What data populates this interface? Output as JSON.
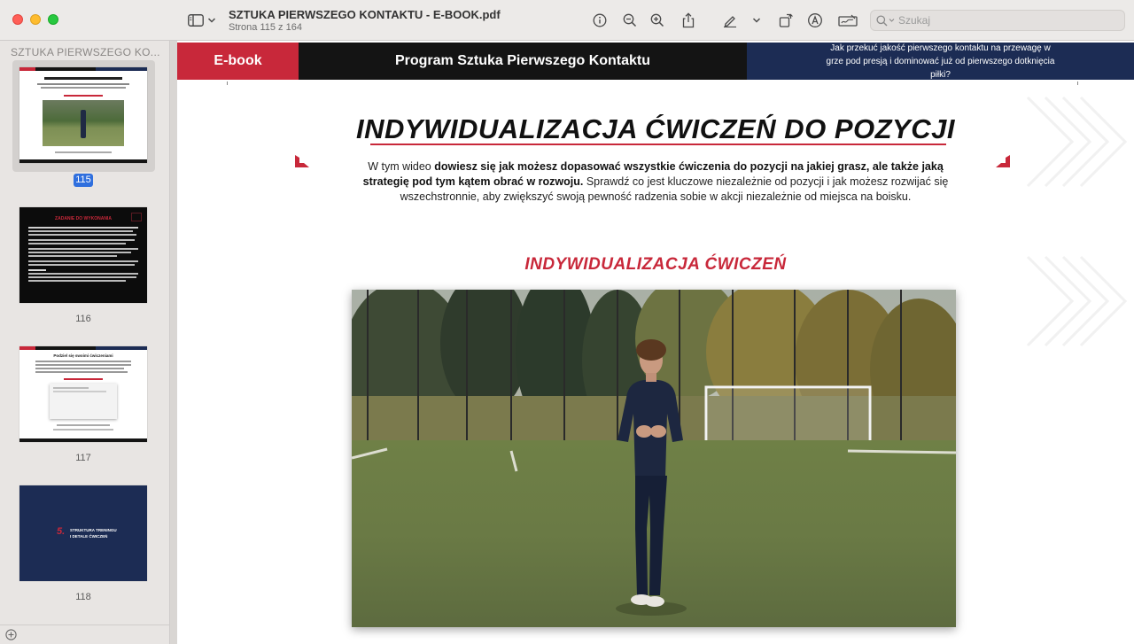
{
  "window": {
    "doc_title": "SZTUKA PIERWSZEGO KONTAKTU - E-BOOK.pdf",
    "page_info": "Strona 115 z 164",
    "search_placeholder": "Szukaj"
  },
  "sidebar": {
    "header": "SZTUKA PIERWSZEGO KO...",
    "pages": [
      {
        "number": "115",
        "selected": true
      },
      {
        "number": "116",
        "selected": false
      },
      {
        "number": "117",
        "selected": false
      },
      {
        "number": "118",
        "selected": false
      }
    ]
  },
  "page": {
    "band_left": "E-book",
    "band_center": "Program Sztuka Pierwszego Kontaktu",
    "band_right": "Jak przekuć jakość pierwszego kontaktu na przewagę w grze pod presją i dominować już od pierwszego dotknięcia piłki?",
    "title": "INDYWIDUALIZACJA ĆWICZEŃ DO POZYCJI",
    "intro_1": "W tym wideo ",
    "intro_bold": "dowiesz się jak możesz dopasować wszystkie ćwiczenia do pozycji na jakiej grasz, ale także jaką strategię pod tym kątem obrać w rozwoju.",
    "intro_2": " Sprawdź co jest kluczowe niezależnie od pozycji i jak możesz rozwijać się wszechstronnie, aby zwiększyć swoją pewność radzenia sobie w akcji niezależnie od miejsca na boisku.",
    "subtitle": "INDYWIDUALIZACJA ĆWICZEŃ"
  },
  "thumbs": {
    "t116_title": "ZADANIE DO WYKONANIA",
    "t117_title": "Podziel się swoimi ćwiczeniami",
    "t118_number": "5.",
    "t118_line1": "STRUKTURA TRENINGU",
    "t118_line2": "I DETALE ĆWICZEŃ"
  },
  "colors": {
    "accent_red": "#c8283a",
    "navy": "#1c2c54",
    "selection_blue": "#2f6fde"
  }
}
